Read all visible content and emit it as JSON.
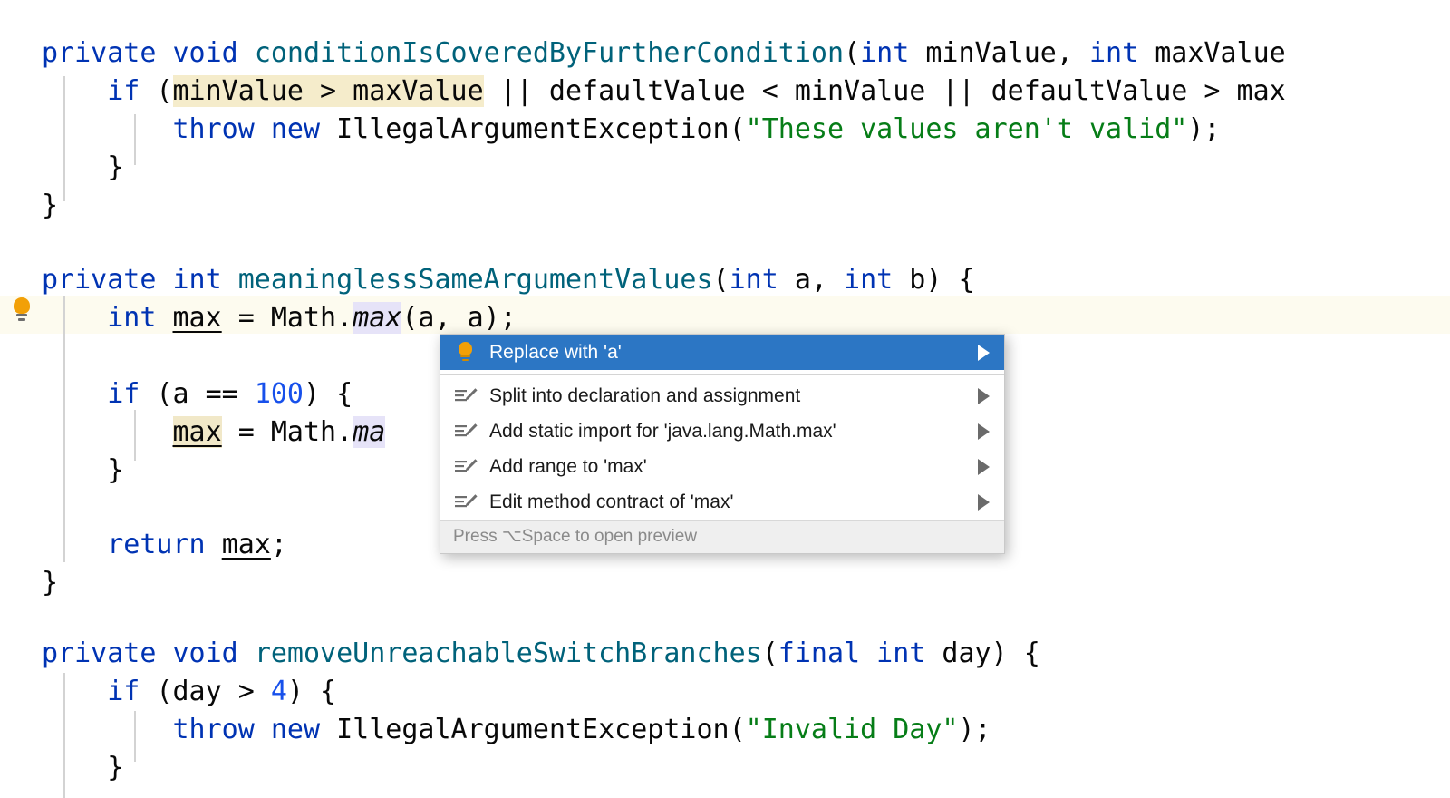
{
  "editor": {
    "language": "java",
    "font_size_px": 30,
    "line_height_px": 42,
    "colors": {
      "background": "#ffffff",
      "caret_line": "#FDFBEF",
      "keyword": "#0033B3",
      "method": "#00627A",
      "string": "#067D17",
      "number": "#1750EB",
      "plain": "#080808",
      "write_usage_highlight": "#F1E8C8",
      "identifier_highlight": "#E6E3F8",
      "condition_highlight": "#F5ECCB",
      "indent_guide": "#D3D3D3"
    },
    "gutter": {
      "intention_bulb_icon": "lightbulb-icon",
      "bulb_color": "#F2A007",
      "bulb_line_number": 2
    },
    "lines": [
      {
        "n": 1,
        "text": "private void conditionIsCoveredByFurtherCondition(int minValue, int maxValue"
      },
      {
        "n": 2,
        "text": "    if (minValue > maxValue || defaultValue < minValue || defaultValue > max"
      },
      {
        "n": 3,
        "text": "        throw new IllegalArgumentException(\"These values aren't valid\");"
      },
      {
        "n": 4,
        "text": "    }"
      },
      {
        "n": 5,
        "text": "}"
      },
      {
        "n": 6,
        "text": ""
      },
      {
        "n": 7,
        "text": "private int meaninglessSameArgumentValues(int a, int b) {"
      },
      {
        "n": 8,
        "text": "    int max = Math.max(a, a);"
      },
      {
        "n": 9,
        "text": ""
      },
      {
        "n": 10,
        "text": "    if (a == 100) {"
      },
      {
        "n": 11,
        "text": "        max = Math.max(a, a);"
      },
      {
        "n": 12,
        "text": "    }"
      },
      {
        "n": 13,
        "text": ""
      },
      {
        "n": 14,
        "text": "    return max;"
      },
      {
        "n": 15,
        "text": "}"
      },
      {
        "n": 16,
        "text": ""
      },
      {
        "n": 17,
        "text": "private void removeUnreachableSwitchBranches(final int day) {"
      },
      {
        "n": 18,
        "text": "    if (day > 4) {"
      },
      {
        "n": 19,
        "text": "        throw new IllegalArgumentException(\"Invalid Day\");"
      },
      {
        "n": 20,
        "text": "    }"
      }
    ],
    "tokens": {
      "l1": {
        "kw1": "private",
        "kw2": "void",
        "method": "conditionIsCoveredByFurtherCondition",
        "p1": "(",
        "kw3": "int",
        "a1": " minValue, ",
        "kw4": "int",
        "a2": " maxValue"
      },
      "l2": {
        "kw": "if",
        "open": " (",
        "hl": "minValue > maxValue",
        "rest": " || defaultValue < minValue || defaultValue > max"
      },
      "l3": {
        "kw1": "throw",
        "kw2": "new",
        "cls": " IllegalArgumentException(",
        "str": "\"These values aren't valid\"",
        "end": ");"
      },
      "l4": {
        "t": "    }"
      },
      "l5": {
        "t": "}"
      },
      "l7": {
        "kw1": "private",
        "kw2": "int",
        "method": "meaninglessSameArgumentValues",
        "p1": "(",
        "kw3": "int",
        "a1": " a, ",
        "kw4": "int",
        "a2": " b) {"
      },
      "l8": {
        "kw": "int",
        "sp": " ",
        "var": "max",
        "eq": " = Math.",
        "mx": "max",
        "tail": "(a, a);"
      },
      "l10": {
        "kw": "if",
        "open": " (a == ",
        "num": "100",
        "close": ") {"
      },
      "l11": {
        "var": "max",
        "eq": " = Math.",
        "mx": "ma"
      },
      "l12": {
        "t": "    }"
      },
      "l14": {
        "kw": "return",
        "sp": " ",
        "var": "max",
        "semi": ";"
      },
      "l15": {
        "t": "}"
      },
      "l17": {
        "kw1": "private",
        "kw2": "void",
        "method": "removeUnreachableSwitchBranches",
        "p1": "(",
        "kw3": "final",
        "sp": " ",
        "kw4": "int",
        "a1": " day) {"
      },
      "l18": {
        "kw": "if",
        "open": " (day > ",
        "num": "4",
        "close": ") {"
      },
      "l19": {
        "kw1": "throw",
        "kw2": "new",
        "cls": " IllegalArgumentException(",
        "str": "\"Invalid Day\"",
        "end": ");"
      },
      "l20": {
        "t": "    }"
      }
    }
  },
  "intention_popup": {
    "selected_index": 0,
    "selected_bg": "#2C76C4",
    "items": [
      {
        "label": "Replace with 'a'",
        "icon": "lightbulb-icon",
        "has_submenu": true,
        "selected": true
      },
      {
        "label": "Split into declaration and assignment",
        "icon": "intention-pencil-icon",
        "has_submenu": true,
        "selected": false
      },
      {
        "label": "Add static import for 'java.lang.Math.max'",
        "icon": "intention-pencil-icon",
        "has_submenu": true,
        "selected": false
      },
      {
        "label": "Add range to 'max'",
        "icon": "intention-pencil-icon",
        "has_submenu": true,
        "selected": false
      },
      {
        "label": "Edit method contract of 'max'",
        "icon": "intention-pencil-icon",
        "has_submenu": true,
        "selected": false
      }
    ],
    "footer": "Press ⌥Space to open preview"
  }
}
